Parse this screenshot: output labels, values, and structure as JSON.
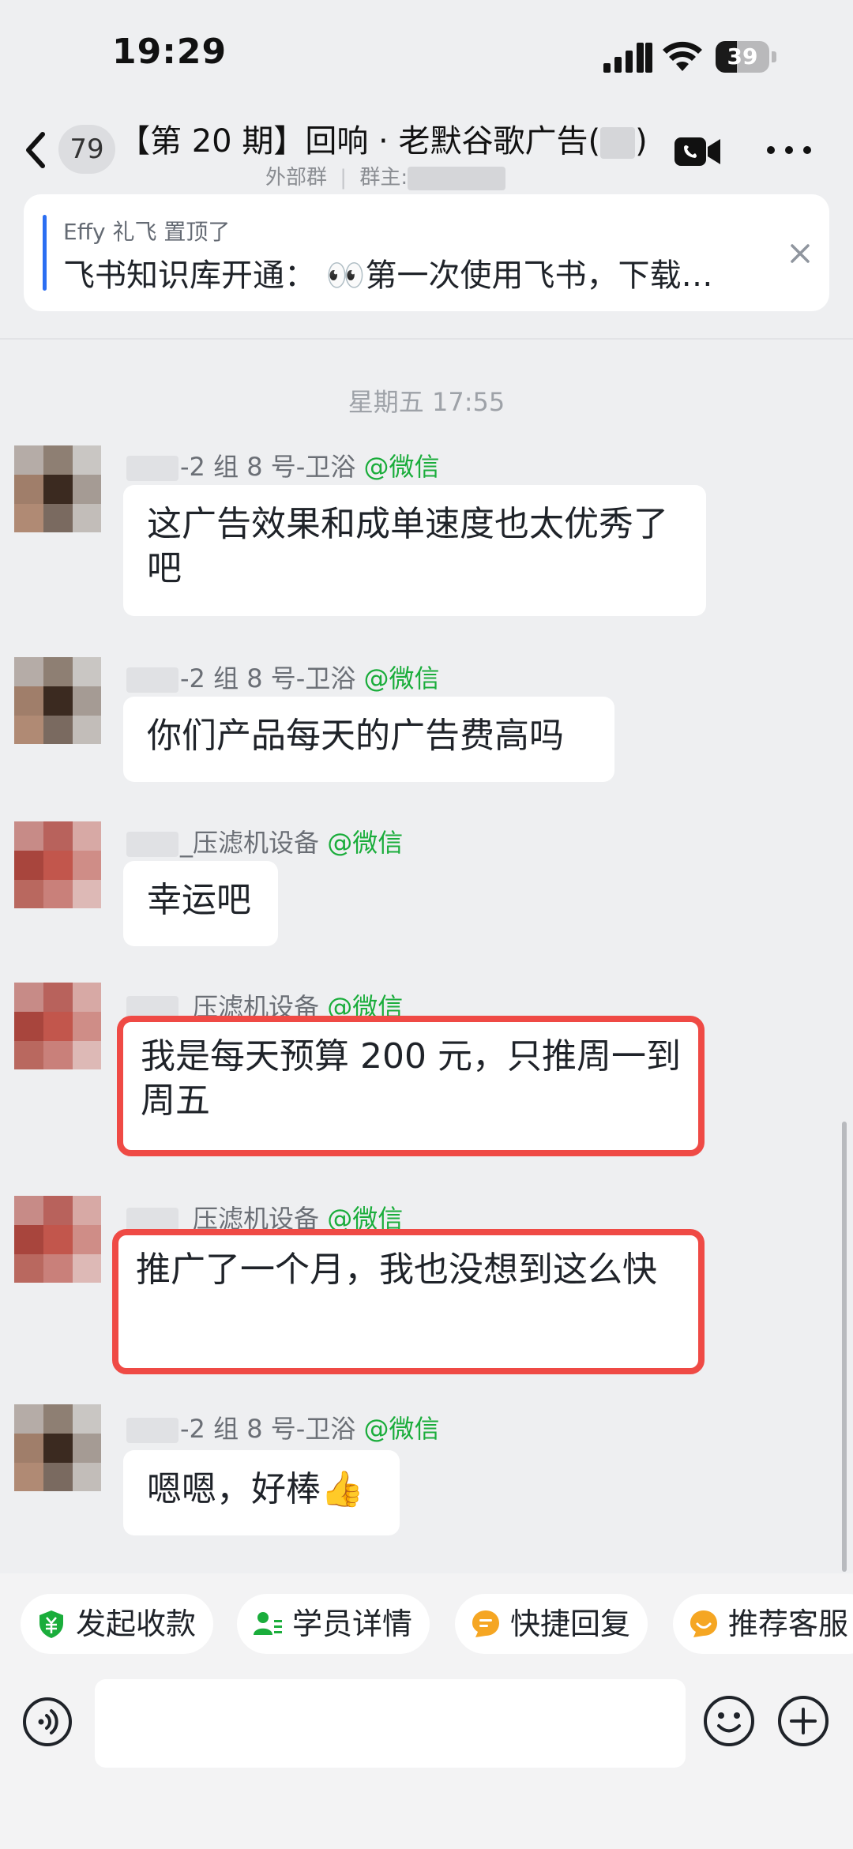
{
  "status_bar": {
    "time": "19:29",
    "battery": "39"
  },
  "header": {
    "unread_count": "79",
    "title": "【第 20 期】回响 · 老默谷歌广告(",
    "title_end": ")",
    "subtitle_type": "外部群",
    "subtitle_owner_label": "群主:"
  },
  "pinned": {
    "author": "Effy 礼飞 置顶了",
    "text": "飞书知识库开通： 👀第一次使用飞书，下载…"
  },
  "day_separator": "星期五 17:55",
  "messages": [
    {
      "sender": "-2 组 8 号-卫浴",
      "origin": "@微信",
      "text": "这广告效果和成单速度也太优秀了吧",
      "highlighted": false
    },
    {
      "sender": "-2 组 8 号-卫浴",
      "origin": "@微信",
      "text": "你们产品每天的广告费高吗",
      "highlighted": false
    },
    {
      "sender": "_压滤机设备",
      "origin": "@微信",
      "text": "幸运吧",
      "highlighted": false
    },
    {
      "sender": "_压滤机设备",
      "origin": "@微信",
      "text": "我是每天预算 200 元，只推周一到周五",
      "highlighted": true
    },
    {
      "sender": "_压滤机设备",
      "origin": "@微信",
      "text": "推广了一个月，我也没想到这么快",
      "highlighted": true
    },
    {
      "sender": "-2 组 8 号-卫浴",
      "origin": "@微信",
      "text": "嗯嗯，好棒👍",
      "highlighted": false
    }
  ],
  "quick_actions": [
    {
      "label": "发起收款",
      "icon": "shield-yen-icon",
      "color": "#1aad3b"
    },
    {
      "label": "学员详情",
      "icon": "user-list-icon",
      "color": "#1aad3b"
    },
    {
      "label": "快捷回复",
      "icon": "chat-bubble-icon",
      "color": "#f5a623"
    },
    {
      "label": "推荐客服",
      "icon": "smile-bubble-icon",
      "color": "#f5a623"
    }
  ],
  "colors": {
    "highlight_border": "#ef4a45",
    "origin_green": "#1aad3b",
    "pin_accent": "#2b6ef2"
  }
}
